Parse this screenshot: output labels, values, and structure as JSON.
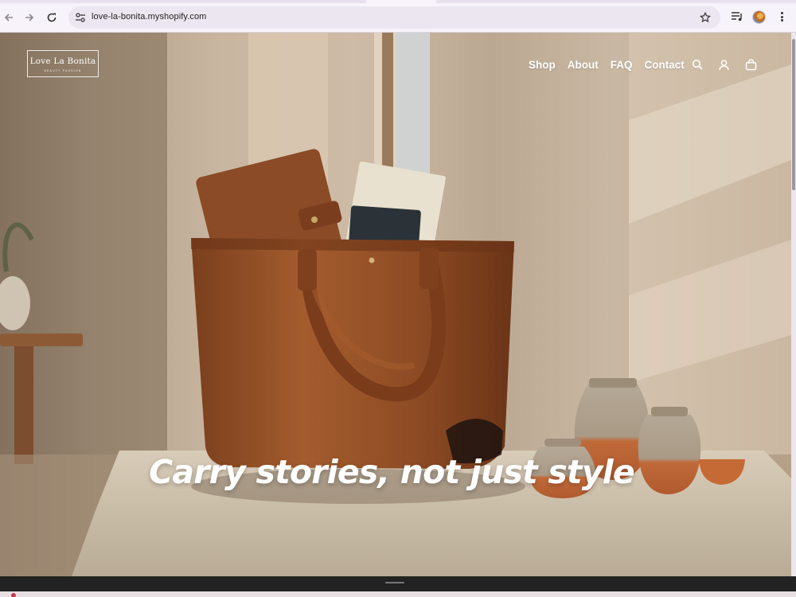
{
  "browser": {
    "url": "love-la-bonita.myshopify.com",
    "icons": {
      "back": "back-arrow-icon",
      "forward": "forward-arrow-icon",
      "reload": "reload-icon",
      "site_info": "site-settings-icon",
      "bookmark": "star-icon",
      "cast": "media-control-icon",
      "profile": "profile-avatar",
      "menu": "kebab-menu-icon"
    }
  },
  "header": {
    "logo_name": "Love La Bonita",
    "logo_tagline": "BEAUTY PASSION",
    "nav": [
      {
        "label": "Shop"
      },
      {
        "label": "About"
      },
      {
        "label": "FAQ"
      },
      {
        "label": "Contact"
      }
    ],
    "icons": [
      "search-icon",
      "account-icon",
      "cart-icon"
    ]
  },
  "hero": {
    "headline": "Carry stories, not just style"
  },
  "colors": {
    "text_on_hero": "#ffffff",
    "leather": "#8a4a24",
    "browser_chrome": "#f7f3fa"
  }
}
